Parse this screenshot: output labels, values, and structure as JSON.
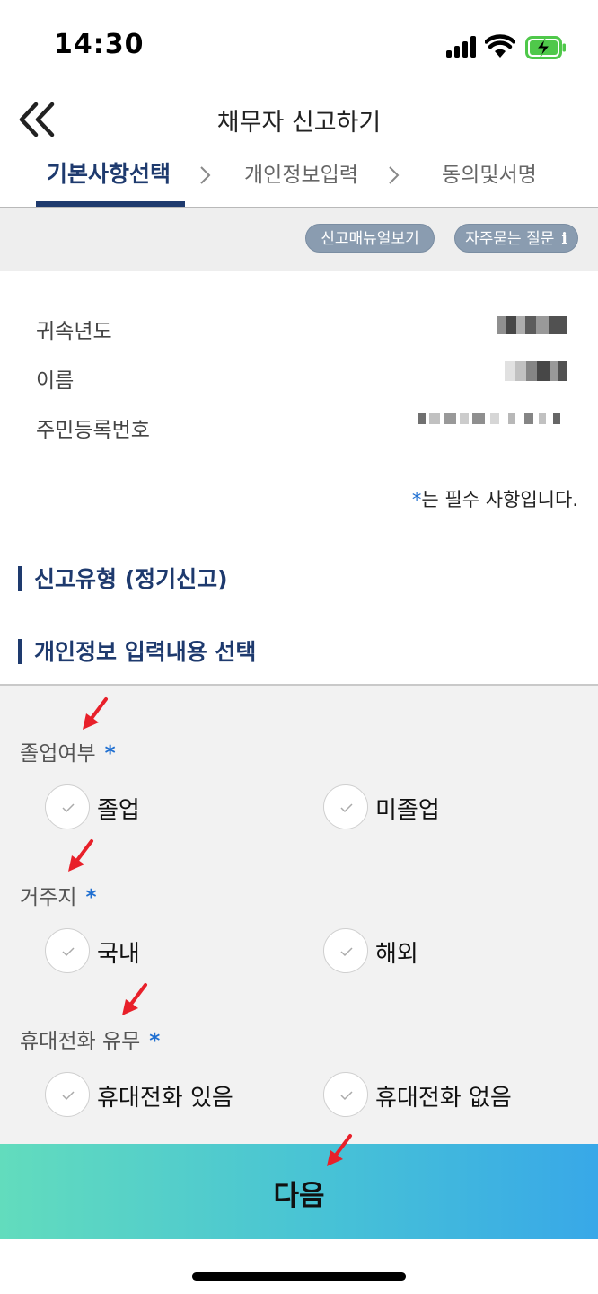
{
  "status_bar": {
    "time": "14:30"
  },
  "header": {
    "title": "채무자 신고하기"
  },
  "steps": [
    {
      "label": "기본사항선택",
      "active": true
    },
    {
      "label": "개인정보입력",
      "active": false
    },
    {
      "label": "동의및서명",
      "active": false
    }
  ],
  "toolbar": {
    "manual_button": "신고매뉴얼보기",
    "faq_button": "자주묻는 질문",
    "faq_icon": "i"
  },
  "info": {
    "fields": [
      {
        "label": "귀속년도"
      },
      {
        "label": "이름"
      },
      {
        "label": "주민등록번호"
      }
    ]
  },
  "required_note": {
    "star": "*",
    "text": "는 필수 사항입니다."
  },
  "sections": {
    "report_type": "신고유형 (정기신고)",
    "personal_info": "개인정보 입력내용 선택"
  },
  "questions": [
    {
      "label": "졸업여부",
      "star": "*",
      "options": [
        "졸업",
        "미졸업"
      ]
    },
    {
      "label": "거주지",
      "star": "*",
      "options": [
        "국내",
        "해외"
      ]
    },
    {
      "label": "휴대전화 유무",
      "star": "*",
      "options": [
        "휴대전화 있음",
        "휴대전화 없음"
      ]
    }
  ],
  "next_button": {
    "label": "다음"
  },
  "colors": {
    "accent": "#1e3a6e",
    "required_star": "#1f6fd1",
    "annotation_arrow": "#e8202a"
  }
}
